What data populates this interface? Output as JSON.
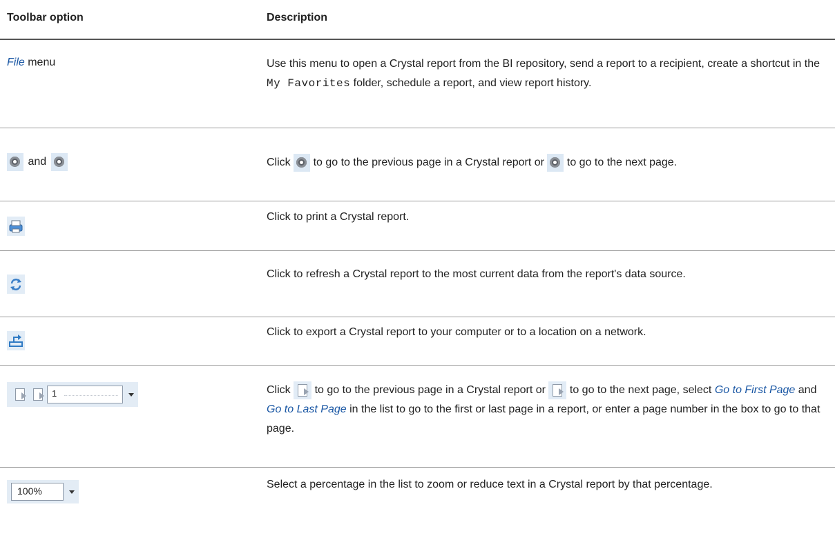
{
  "header": {
    "col1": "Toolbar option",
    "col2": "Description"
  },
  "rows": {
    "file": {
      "option_link": "File",
      "option_suffix": " menu",
      "desc_part1": "Use this menu to open a Crystal report from the BI repository, send a report to a recipient, create a shortcut in the ",
      "desc_mono": "My Favorites",
      "desc_part2": " folder, schedule a report, and view report history."
    },
    "nav": {
      "and": "and",
      "desc_click": "Click",
      "desc_mid": "to go to the previous page in a Crystal report or",
      "desc_end": "to go to the next page."
    },
    "print": {
      "desc": "Click to print a Crystal report."
    },
    "refresh": {
      "desc": "Click to refresh a Crystal report to the most current data from the report's data source."
    },
    "export": {
      "desc": "Click to export a Crystal report to your computer or to a location on a network."
    },
    "pages": {
      "page_value": "1",
      "desc_click": "Click",
      "desc_mid": "to go to the previous page in a Crystal report or",
      "desc_after_icon": "to go to the next page, select",
      "link_first": "Go to First Page",
      "and": "and",
      "link_last": "Go to Last Page",
      "desc_end": "in the list to go to the first or last page in a report, or enter a page number in the box to go to that page."
    },
    "zoom": {
      "value": "100%",
      "desc": "Select a percentage in the list to zoom or reduce text in a Crystal report by that percentage."
    }
  },
  "icons": {
    "prev": "previous-page-icon",
    "next": "next-page-icon",
    "print": "printer-icon",
    "refresh": "refresh-icon",
    "export": "export-icon",
    "accent": "#1a57a4"
  }
}
